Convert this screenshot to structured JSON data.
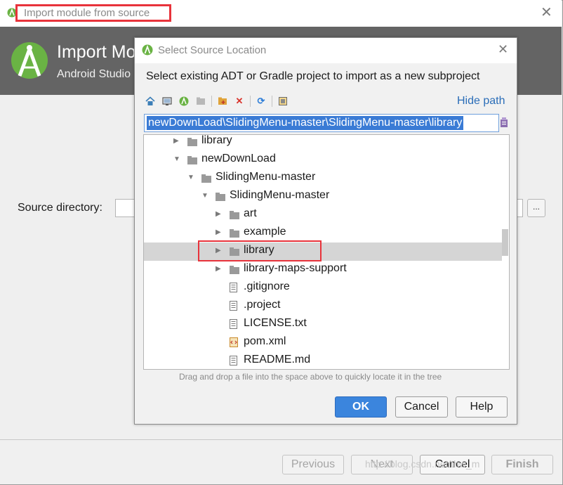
{
  "outer_dialog": {
    "title": "Import module from source",
    "header_title": "Import Module from Source",
    "header_subtitle": "Android Studio",
    "source_label": "Source directory:",
    "browse_label": "...",
    "buttons": {
      "previous": "Previous",
      "next": "Next",
      "cancel": "Cancel",
      "finish": "Finish"
    }
  },
  "inner_dialog": {
    "title": "Select Source Location",
    "description": "Select existing ADT or Gradle project to import as a new subproject",
    "hide_path": "Hide path",
    "path": "newDownLoad\\SlidingMenu-master\\SlidingMenu-master\\library",
    "tree": [
      {
        "label": "library",
        "type": "folder",
        "depth": 0,
        "arrow": "collapsed"
      },
      {
        "label": "newDownLoad",
        "type": "folder",
        "depth": 0,
        "arrow": "expanded"
      },
      {
        "label": "SlidingMenu-master",
        "type": "folder",
        "depth": 1,
        "arrow": "expanded"
      },
      {
        "label": "SlidingMenu-master",
        "type": "folder",
        "depth": 2,
        "arrow": "expanded"
      },
      {
        "label": "art",
        "type": "folder",
        "depth": 3,
        "arrow": "collapsed"
      },
      {
        "label": "example",
        "type": "folder",
        "depth": 3,
        "arrow": "collapsed"
      },
      {
        "label": "library",
        "type": "folder",
        "depth": 3,
        "arrow": "collapsed",
        "selected": true
      },
      {
        "label": "library-maps-support",
        "type": "folder",
        "depth": 3,
        "arrow": "collapsed"
      },
      {
        "label": ".gitignore",
        "type": "file",
        "depth": 3
      },
      {
        "label": ".project",
        "type": "file",
        "depth": 3
      },
      {
        "label": "LICENSE.txt",
        "type": "file",
        "depth": 3
      },
      {
        "label": "pom.xml",
        "type": "xml",
        "depth": 3
      },
      {
        "label": "README.md",
        "type": "file",
        "depth": 3
      }
    ],
    "hint": "Drag and drop a file into the space above to quickly locate it in the tree",
    "buttons": {
      "ok": "OK",
      "cancel": "Cancel",
      "help": "Help"
    }
  },
  "watermark": "http://blog.csdn.net/thw_m",
  "colors": {
    "accent": "#3b85dd",
    "highlight_box": "#e8333b",
    "selection": "#d5d5d5"
  }
}
